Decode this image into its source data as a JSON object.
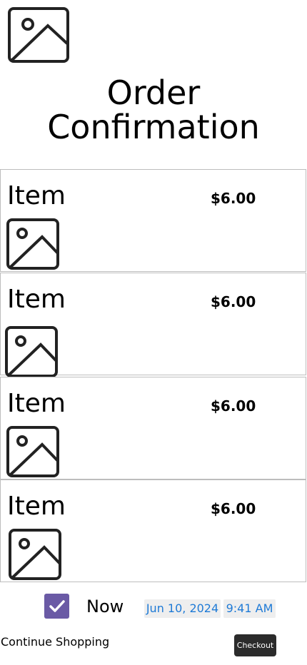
{
  "header": {
    "image_icon": "image-placeholder-icon",
    "title": "Order Confirmation"
  },
  "items": [
    {
      "name": "Item",
      "price": "$6.00",
      "icon": "image-placeholder-icon"
    },
    {
      "name": "Item",
      "price": "$6.00",
      "icon": "image-placeholder-icon"
    },
    {
      "name": "Item",
      "price": "$6.00",
      "icon": "image-placeholder-icon"
    },
    {
      "name": "Item",
      "price": "$6.00",
      "icon": "image-placeholder-icon"
    }
  ],
  "schedule": {
    "checked": true,
    "label": "Now",
    "date": "Jun 10, 2024",
    "time": "9:41 AM",
    "accent_color": "#6a5aa5",
    "link_color": "#1e7ad6"
  },
  "footer": {
    "continue_label": "Continue Shopping",
    "checkout_label": "Checkout"
  }
}
